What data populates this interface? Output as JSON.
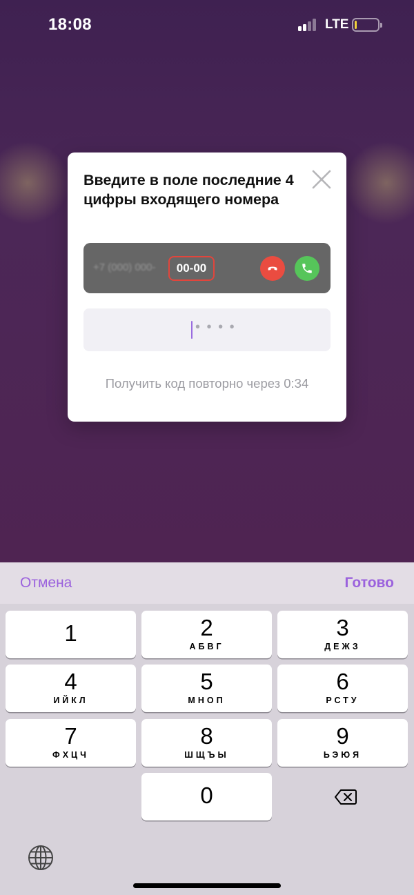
{
  "status_bar": {
    "time": "18:08",
    "network": "LTE",
    "battery_level_percent": 10
  },
  "dialog": {
    "title": "Введите в поле последние 4 цифры входящего номера",
    "close_icon": "close-icon",
    "call_banner": {
      "number_prefix": "+7 (000) 000-",
      "digits": "00-00",
      "decline_icon": "phone-decline-icon",
      "accept_icon": "phone-accept-icon"
    },
    "code_input": {
      "placeholder": "• • • •",
      "value": ""
    },
    "resend_text": "Получить код повторно через 0:34"
  },
  "keyboard": {
    "cancel_label": "Отмена",
    "done_label": "Готово",
    "keys": [
      {
        "digit": "1",
        "letters": ""
      },
      {
        "digit": "2",
        "letters": "АБВГ"
      },
      {
        "digit": "3",
        "letters": "ДЕЖЗ"
      },
      {
        "digit": "4",
        "letters": "ИЙКЛ"
      },
      {
        "digit": "5",
        "letters": "МНОП"
      },
      {
        "digit": "6",
        "letters": "РСТУ"
      },
      {
        "digit": "7",
        "letters": "ФХЦЧ"
      },
      {
        "digit": "8",
        "letters": "ШЩЪЫ"
      },
      {
        "digit": "9",
        "letters": "ЬЭЮЯ"
      },
      {
        "digit": "0",
        "letters": ""
      }
    ],
    "backspace_icon": "backspace-icon",
    "globe_icon": "globe-icon"
  },
  "colors": {
    "accent": "#9b62dd",
    "decline": "#ea4c40",
    "accept": "#56c55a",
    "highlight_border": "#e2453c"
  }
}
